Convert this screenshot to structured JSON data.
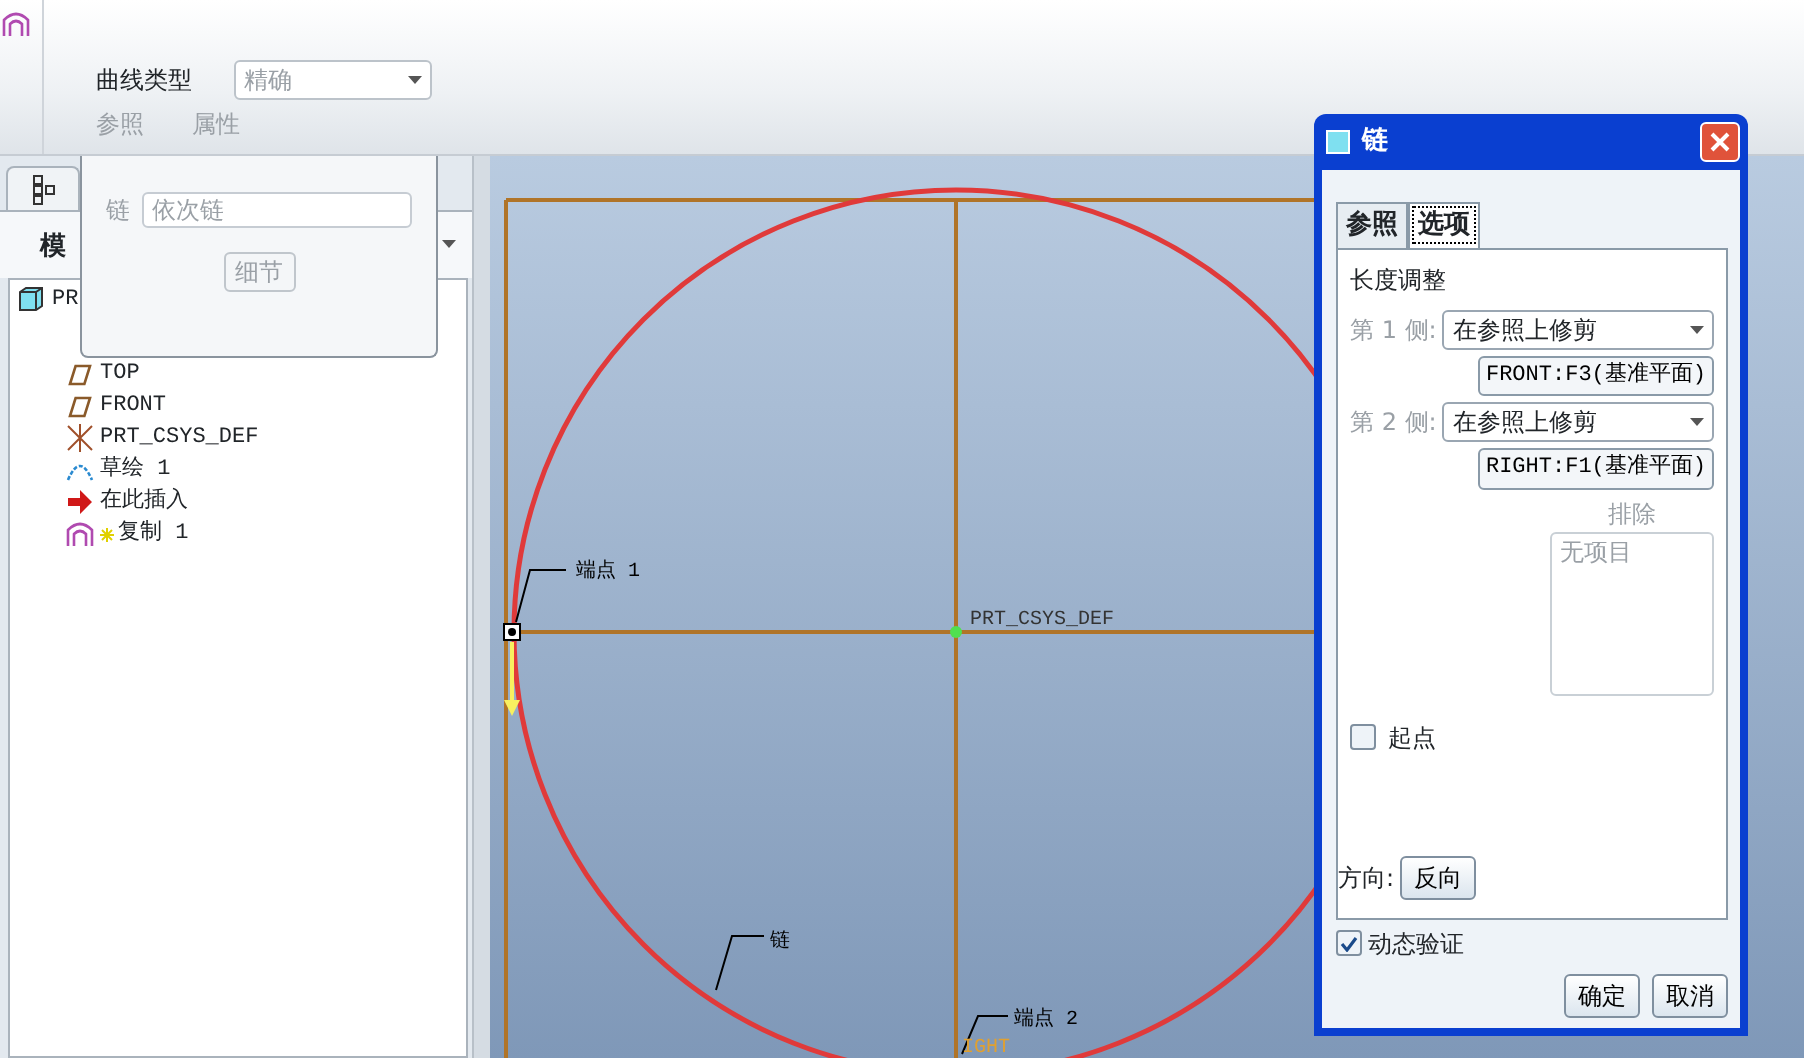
{
  "ribbon": {
    "curve_type": {
      "label": "曲线类型",
      "value": "精确",
      "disabled": true
    },
    "tabs": [
      {
        "label": "参照",
        "disabled": true
      },
      {
        "label": "属性",
        "disabled": true
      }
    ]
  },
  "references_panel": {
    "chain_label": "链",
    "chain_field": {
      "value": "依次链",
      "disabled": true
    },
    "details_button": {
      "label": "细节",
      "disabled": true
    }
  },
  "model_tree": {
    "header": "模",
    "items": [
      {
        "label": "PR",
        "kind": "part",
        "children": [
          {
            "label": "TOP",
            "kind": "plane"
          },
          {
            "label": "FRONT",
            "kind": "plane"
          },
          {
            "label": "PRT_CSYS_DEF",
            "kind": "csys"
          },
          {
            "label": "草绘 1",
            "kind": "sketch"
          },
          {
            "label": "在此插入",
            "kind": "insert"
          },
          {
            "label": "复制 1",
            "kind": "copy",
            "new": true
          }
        ]
      }
    ]
  },
  "viewport": {
    "labels": [
      {
        "text": "端点 1",
        "kind": "callout"
      },
      {
        "text": "PRT_CSYS_DEF",
        "kind": "datum"
      },
      {
        "text": "链",
        "kind": "callout"
      },
      {
        "text": "端点 2",
        "kind": "callout"
      },
      {
        "text": "IGHT",
        "kind": "plane"
      }
    ]
  },
  "dialog": {
    "title": "链",
    "tabs": [
      {
        "label": "参照",
        "selected": false
      },
      {
        "label": "选项",
        "selected": true
      }
    ],
    "length_section": "长度调整",
    "sides": [
      {
        "label": "第 1 侧:",
        "option": "在参照上修剪",
        "reference": "FRONT:F3(基准平面)"
      },
      {
        "label": "第 2 侧:",
        "option": "在参照上修剪",
        "reference": "RIGHT:F1(基准平面)"
      }
    ],
    "exclude": {
      "label": "排除",
      "placeholder": "无项目"
    },
    "start_point": {
      "label": "起点",
      "checked": false
    },
    "direction": {
      "label": "方向:",
      "button": "反向"
    },
    "dynamic_check": {
      "label": "动态验证",
      "checked": true
    },
    "buttons": [
      "确定",
      "取消"
    ]
  }
}
